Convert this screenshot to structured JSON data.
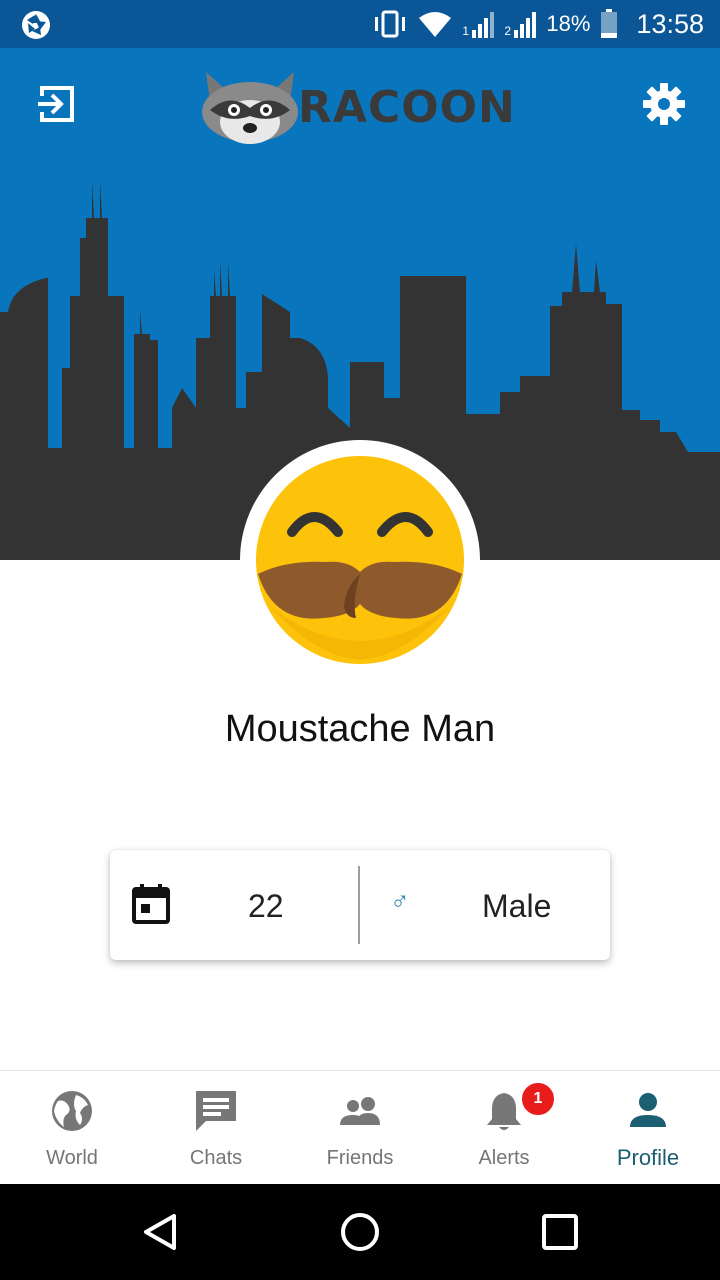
{
  "status_bar": {
    "battery_percent": "18%",
    "time": "13:58",
    "sim1_label": "1",
    "sim2_label": "2",
    "icons": [
      "aperture-icon",
      "vibrate-icon",
      "wifi-icon",
      "signal-icon",
      "battery-icon"
    ]
  },
  "header": {
    "logo_text": "RACOON",
    "left_icon": "logout-icon",
    "right_icon": "settings-gear-icon"
  },
  "profile": {
    "name": "Moustache Man",
    "avatar": "moustache-emoji-avatar",
    "age": "22",
    "gender_symbol": "♂",
    "gender": "Male"
  },
  "bottom_nav": {
    "items": [
      {
        "label": "World",
        "icon": "globe-icon"
      },
      {
        "label": "Chats",
        "icon": "chat-icon"
      },
      {
        "label": "Friends",
        "icon": "friends-icon"
      },
      {
        "label": "Alerts",
        "icon": "bell-icon"
      },
      {
        "label": "Profile",
        "icon": "person-icon"
      }
    ],
    "active": "Profile",
    "alerts_badge": "1"
  },
  "colors": {
    "status_bar": "#0a5696",
    "sky": "#0975bd",
    "skyline": "#333333",
    "avatar_yellow": "#fdc20a",
    "moustache": "#8e5a2c",
    "active_nav": "#1c5e72",
    "badge": "#e91c1c"
  }
}
